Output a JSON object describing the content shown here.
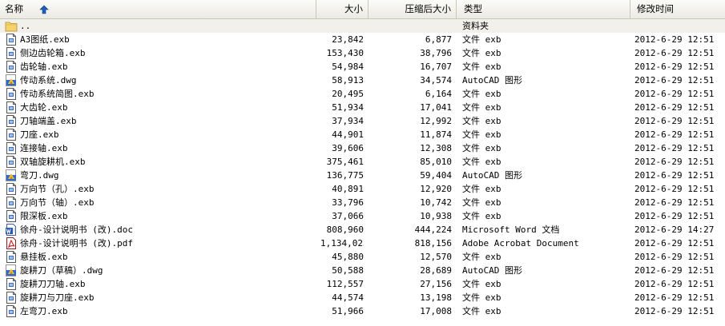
{
  "header": {
    "name": "名称",
    "size": "大小",
    "compressed": "压缩后大小",
    "type": "类型",
    "modified": "修改时间"
  },
  "files": [
    {
      "name": "..",
      "size": "",
      "compressed": "",
      "type": "资料夹",
      "modified": "",
      "icon": "folder-icon"
    },
    {
      "name": "A3图纸.exb",
      "size": "23,842",
      "compressed": "6,877",
      "type": "文件 exb",
      "modified": "2012-6-29 12:51",
      "icon": "generic-file-icon"
    },
    {
      "name": "侧边齿轮箱.exb",
      "size": "153,430",
      "compressed": "38,796",
      "type": "文件 exb",
      "modified": "2012-6-29 12:51",
      "icon": "generic-file-icon"
    },
    {
      "name": "齿轮轴.exb",
      "size": "54,984",
      "compressed": "16,707",
      "type": "文件 exb",
      "modified": "2012-6-29 12:51",
      "icon": "generic-file-icon"
    },
    {
      "name": "传动系统.dwg",
      "size": "58,913",
      "compressed": "34,574",
      "type": "AutoCAD 图形",
      "modified": "2012-6-29 12:51",
      "icon": "autocad-file-icon"
    },
    {
      "name": "传动系统简图.exb",
      "size": "20,495",
      "compressed": "6,164",
      "type": "文件 exb",
      "modified": "2012-6-29 12:51",
      "icon": "generic-file-icon"
    },
    {
      "name": "大齿轮.exb",
      "size": "51,934",
      "compressed": "17,041",
      "type": "文件 exb",
      "modified": "2012-6-29 12:51",
      "icon": "generic-file-icon"
    },
    {
      "name": "刀轴端盖.exb",
      "size": "37,934",
      "compressed": "12,992",
      "type": "文件 exb",
      "modified": "2012-6-29 12:51",
      "icon": "generic-file-icon"
    },
    {
      "name": "刀座.exb",
      "size": "44,901",
      "compressed": "11,874",
      "type": "文件 exb",
      "modified": "2012-6-29 12:51",
      "icon": "generic-file-icon"
    },
    {
      "name": "连接轴.exb",
      "size": "39,606",
      "compressed": "12,308",
      "type": "文件 exb",
      "modified": "2012-6-29 12:51",
      "icon": "generic-file-icon"
    },
    {
      "name": "双轴旋耕机.exb",
      "size": "375,461",
      "compressed": "85,010",
      "type": "文件 exb",
      "modified": "2012-6-29 12:51",
      "icon": "generic-file-icon"
    },
    {
      "name": "弯刀.dwg",
      "size": "136,775",
      "compressed": "59,404",
      "type": "AutoCAD 图形",
      "modified": "2012-6-29 12:51",
      "icon": "autocad-file-icon"
    },
    {
      "name": "万向节（孔）.exb",
      "size": "40,891",
      "compressed": "12,920",
      "type": "文件 exb",
      "modified": "2012-6-29 12:51",
      "icon": "generic-file-icon"
    },
    {
      "name": "万向节（轴）.exb",
      "size": "33,796",
      "compressed": "10,742",
      "type": "文件 exb",
      "modified": "2012-6-29 12:51",
      "icon": "generic-file-icon"
    },
    {
      "name": "限深板.exb",
      "size": "37,066",
      "compressed": "10,938",
      "type": "文件 exb",
      "modified": "2012-6-29 12:51",
      "icon": "generic-file-icon"
    },
    {
      "name": "徐舟-设计说明书 (改).doc",
      "size": "808,960",
      "compressed": "444,224",
      "type": "Microsoft Word 文档",
      "modified": "2012-6-29 14:27",
      "icon": "word-doc-icon"
    },
    {
      "name": "徐舟-设计说明书 (改).pdf",
      "size": "1,134,023",
      "compressed": "818,156",
      "type": "Adobe Acrobat Document",
      "modified": "2012-6-29 12:51",
      "icon": "pdf-file-icon"
    },
    {
      "name": "悬挂板.exb",
      "size": "45,880",
      "compressed": "12,570",
      "type": "文件 exb",
      "modified": "2012-6-29 12:51",
      "icon": "generic-file-icon"
    },
    {
      "name": "旋耕刀（草稿）.dwg",
      "size": "50,588",
      "compressed": "28,689",
      "type": "AutoCAD 图形",
      "modified": "2012-6-29 12:51",
      "icon": "autocad-file-icon"
    },
    {
      "name": "旋耕刀刀轴.exb",
      "size": "112,557",
      "compressed": "27,156",
      "type": "文件 exb",
      "modified": "2012-6-29 12:51",
      "icon": "generic-file-icon"
    },
    {
      "name": "旋耕刀与刀座.exb",
      "size": "44,574",
      "compressed": "13,198",
      "type": "文件 exb",
      "modified": "2012-6-29 12:51",
      "icon": "generic-file-icon"
    },
    {
      "name": "左弯刀.exb",
      "size": "51,966",
      "compressed": "17,008",
      "type": "文件 exb",
      "modified": "2012-6-29 12:51",
      "icon": "generic-file-icon"
    }
  ]
}
